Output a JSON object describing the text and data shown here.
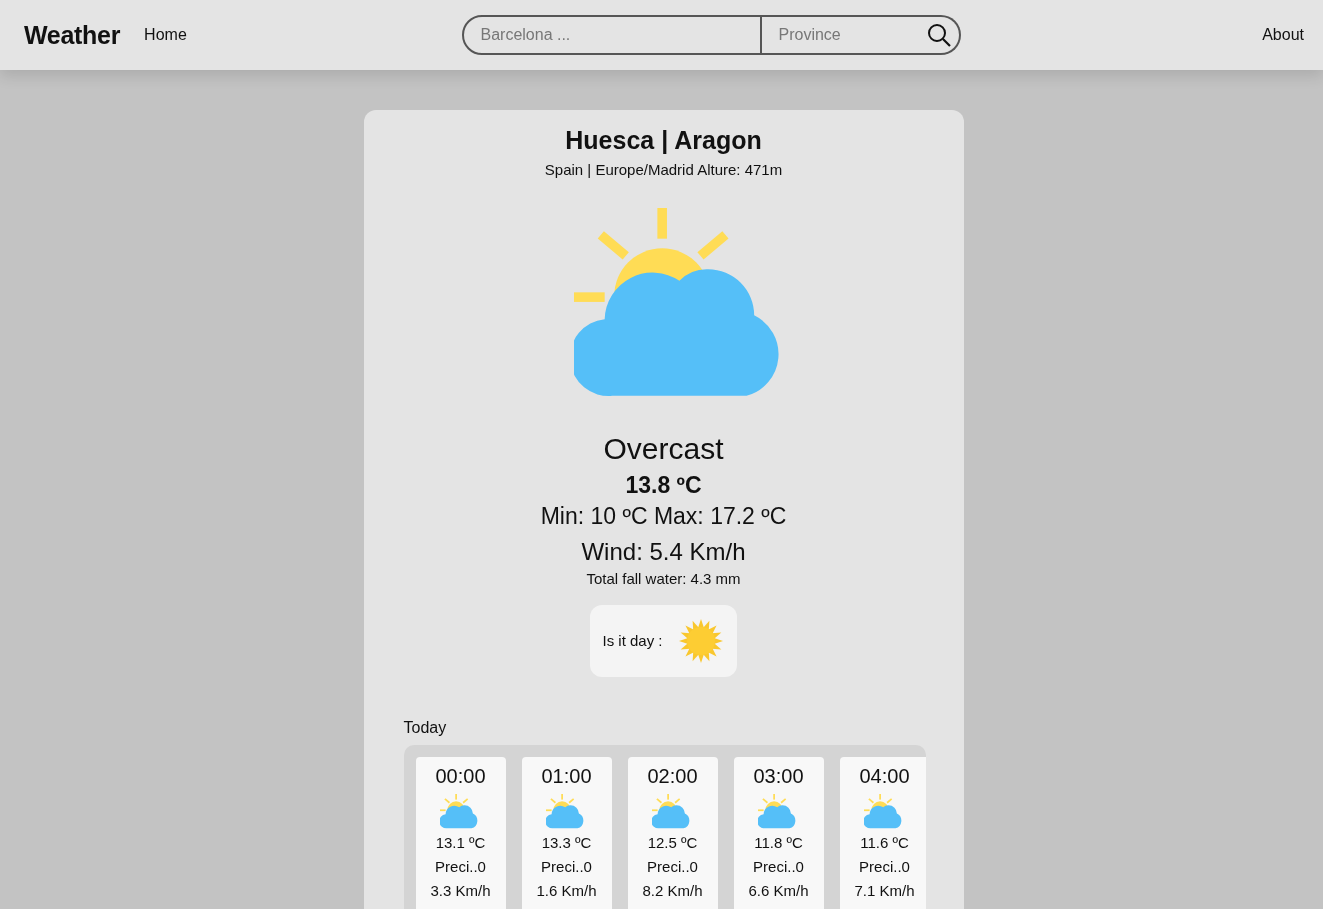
{
  "navbar": {
    "brand": "Weather",
    "links": [
      {
        "label": "Home"
      },
      {
        "label": "About"
      }
    ],
    "search": {
      "city_placeholder": "Barcelona ...",
      "province_placeholder": "Province"
    }
  },
  "location": {
    "title": "Huesca | Aragon",
    "subtitle": "Spain | Europe/Madrid Alture: 471m"
  },
  "current": {
    "condition": "Overcast",
    "temperature": "13.8 ºC",
    "min_max": "Min: 10 ºC Max: 17.2 ºC",
    "wind": "Wind: 5.4 Km/h",
    "total_fall_water": "Total fall water: 4.3 mm"
  },
  "day_indicator": {
    "label": "Is it day :",
    "is_day": true
  },
  "today": {
    "heading": "Today",
    "hours": [
      {
        "time": "00:00",
        "temperature": "13.1 ºC",
        "precipitation": "Preci..0",
        "wind": "3.3 Km/h"
      },
      {
        "time": "01:00",
        "temperature": "13.3 ºC",
        "precipitation": "Preci..0",
        "wind": "1.6 Km/h"
      },
      {
        "time": "02:00",
        "temperature": "12.5 ºC",
        "precipitation": "Preci..0",
        "wind": "8.2 Km/h"
      },
      {
        "time": "03:00",
        "temperature": "11.8 ºC",
        "precipitation": "Preci..0",
        "wind": "6.6 Km/h"
      },
      {
        "time": "04:00",
        "temperature": "11.6 ºC",
        "precipitation": "Preci..0",
        "wind": "7.1 Km/h"
      }
    ]
  }
}
